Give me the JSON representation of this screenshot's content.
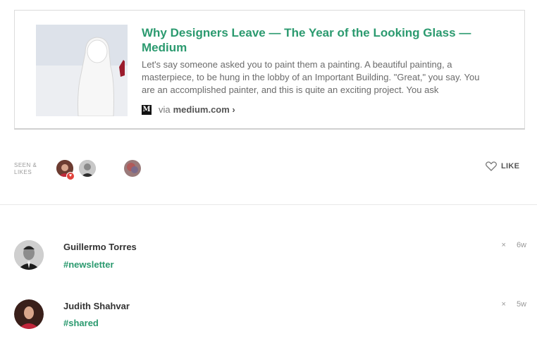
{
  "card": {
    "title": "Why Designers Leave — The Year of the Looking Glass — Medium",
    "description": "Let's say someone asked you to paint them a painting. A beautiful painting, a masterpiece, to be hung in the lobby of an Important Building. \"Great,\" you say. You are an accomplished painter, and this is quite an exciting project. You ask",
    "via": "via",
    "domain": "medium.com ›",
    "source_icon": "M"
  },
  "seen": {
    "label_line1": "SEEN &",
    "label_line2": "LIKES"
  },
  "like_label": "LIKE",
  "comments": [
    {
      "name": "Guillermo Torres",
      "tag": "#newsletter",
      "close": "×",
      "age": "6w"
    },
    {
      "name": "Judith Shahvar",
      "tag": "#shared",
      "close": "×",
      "age": "5w"
    }
  ],
  "colors": {
    "accent": "#2b9a6f",
    "heart": "#e2433c"
  }
}
